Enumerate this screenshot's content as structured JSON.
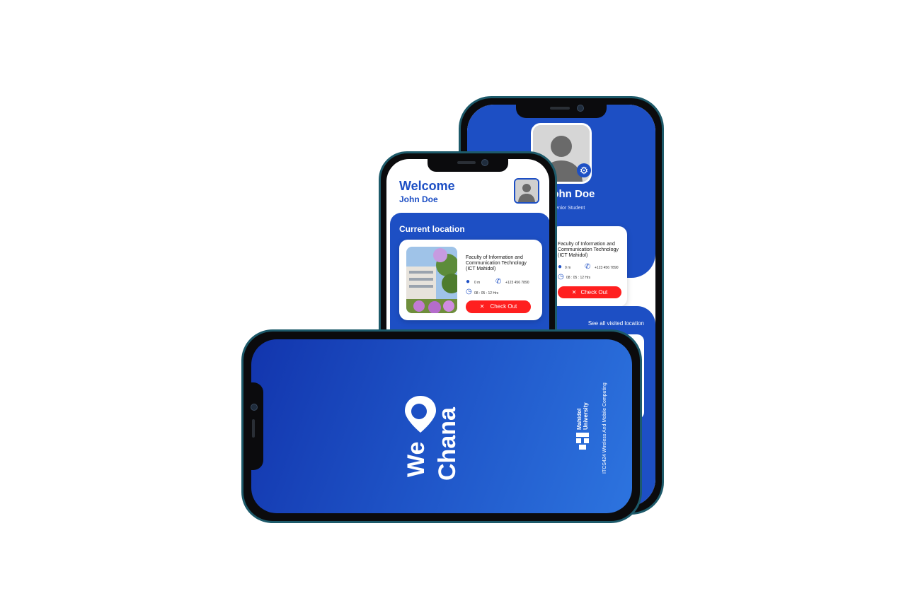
{
  "profile_screen": {
    "name": "John Doe",
    "role": "Senior Student",
    "location_card": {
      "place": "Faculty of Information and Communication Technology (ICT Mahidol)",
      "distance": "0 m",
      "phone": "+123 456 7890",
      "duration": "08 : 05 : 12 Hrs",
      "checkout_label": "Check Out"
    },
    "see_all_label": "See all visited location"
  },
  "home_screen": {
    "welcome": "Welcome",
    "user_name": "John Doe",
    "section_title": "Current location",
    "location_card": {
      "place": "Faculty of Information and Communication Technology (ICT Mahidol)",
      "distance": "0 m",
      "phone": "+123 456 7890",
      "duration": "08 : 05 : 12 Hrs",
      "checkout_label": "Check Out"
    }
  },
  "splash_screen": {
    "brand_line1": "We",
    "brand_line2": "Chana",
    "university_line1": "Mahidol",
    "university_line2": "University",
    "course": "ITCS424 Wireless And Mobile Computing"
  },
  "colors": {
    "primary_blue": "#1d4fc4",
    "danger_red": "#ff1f1f",
    "gradient_start": "#1235ad",
    "gradient_end": "#2d74df"
  },
  "icons": [
    "location-pin-icon",
    "phone-icon",
    "clock-icon",
    "close-x-icon",
    "gear-icon",
    "user-avatar-icon",
    "map-pin-logo-icon",
    "university-seal-icon"
  ]
}
